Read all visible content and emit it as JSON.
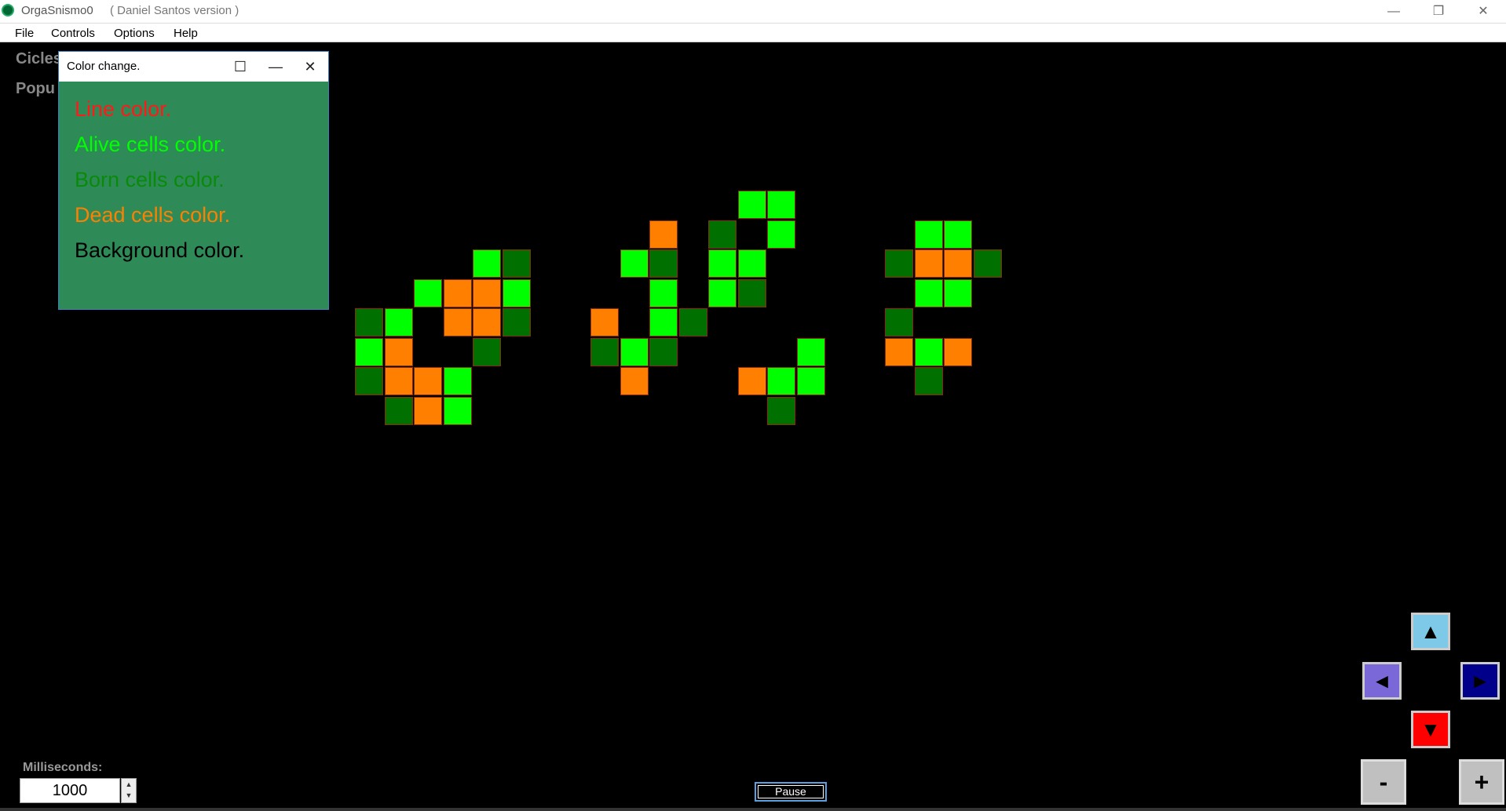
{
  "window": {
    "title": "OrgaSnismo0",
    "subtitle": "( Daniel Santos version )",
    "controls": {
      "minimize": "—",
      "restore": "❐",
      "close": "✕"
    }
  },
  "menu": [
    "File",
    "Controls",
    "Options",
    "Help"
  ],
  "hud": {
    "cicles": "Cicles",
    "population": "Popu"
  },
  "dialog": {
    "title": "Color change.",
    "controls": {
      "minimize": "—",
      "maximize": "☐",
      "close": "✕"
    },
    "options": [
      {
        "label": "Line color.",
        "color": "#ff1a1a"
      },
      {
        "label": "Alive cells color.",
        "color": "#00ff00"
      },
      {
        "label": "Born cells color.",
        "color": "#0a8a0a"
      },
      {
        "label": "Dead cells color.",
        "color": "#ff8000"
      },
      {
        "label": "Background color.",
        "color": "#000000"
      }
    ]
  },
  "colors": {
    "alive": "#00ff00",
    "born": "#007000",
    "dead": "#ff8000",
    "line": "#8a2a10",
    "background": "#000000"
  },
  "milliseconds": {
    "label": "Milliseconds:",
    "value": "1000"
  },
  "pause_label": "Pause",
  "nav": {
    "up": "▲",
    "left": "◄",
    "right": "►",
    "down": "▼"
  },
  "zoom": {
    "out": "-",
    "in": "+"
  }
}
